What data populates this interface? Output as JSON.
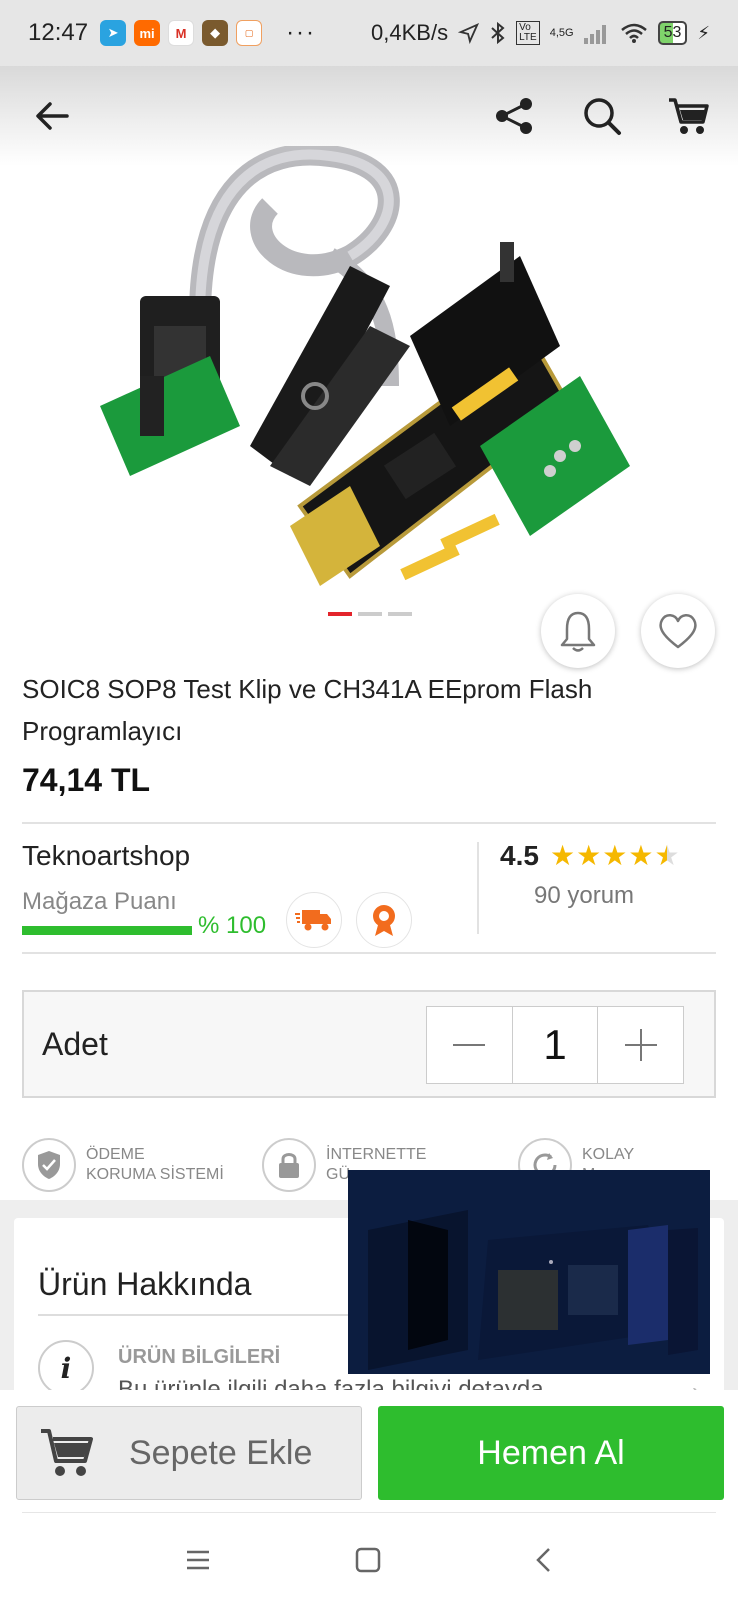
{
  "status_bar": {
    "time": "12:47",
    "dots": "···",
    "speed": "0,4KB/s",
    "network": "4,5G",
    "battery": "53"
  },
  "header": {
    "back_icon": "arrow-left-icon",
    "share_icon": "share-icon",
    "search_icon": "search-icon",
    "cart_icon": "cart-icon"
  },
  "product": {
    "title": "SOIC8 SOP8 Test Klip ve CH341A EEprom Flash Programlayıcı",
    "price": "74,14 TL",
    "image_count": 3,
    "active_image": 1
  },
  "store": {
    "name": "Teknoartshop",
    "score_label": "Mağaza Puanı",
    "score_pct": "% 100",
    "score_value": 100,
    "rating": "4.5",
    "rating_value": 4.5,
    "reviews": "90 yorum"
  },
  "quantity": {
    "label": "Adet",
    "value": "1",
    "minus": "—",
    "plus": "+"
  },
  "guarantees": [
    {
      "line1": "ÖDEME",
      "line2": "KORUMA SİSTEMİ"
    },
    {
      "line1": "İNTERNETTE",
      "line2": "GÜ"
    },
    {
      "line1": "KOLAY",
      "line2": "M"
    }
  ],
  "about": {
    "title": "Ürün Hakkında",
    "info_head": "ÜRÜN BİLGİLERİ",
    "info_sub": "Bu ürünle ilgili daha fazla bilgiyi detayda",
    "info_icon": "i"
  },
  "actions": {
    "add_to_cart": "Sepete Ekle",
    "buy_now": "Hemen Al"
  },
  "colors": {
    "accent_green": "#2ebd2e",
    "accent_red": "#e3242b",
    "star": "#f5b800"
  }
}
